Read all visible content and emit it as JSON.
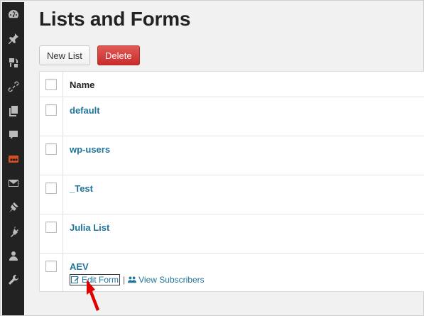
{
  "page": {
    "title": "Lists and Forms"
  },
  "toolbar": {
    "new_list_label": "New List",
    "delete_label": "Delete"
  },
  "table": {
    "name_header": "Name"
  },
  "rows": [
    {
      "name": "default"
    },
    {
      "name": "wp-users"
    },
    {
      "name": "_Test"
    },
    {
      "name": "Julia List"
    },
    {
      "name": "AEV",
      "edit_form": "Edit Form",
      "separator": "|",
      "view_subscribers": "View Subscribers"
    }
  ],
  "sidebar": {
    "icons": [
      "dashboard-icon",
      "pin-icon",
      "media-icon",
      "link-icon",
      "pages-icon",
      "comments-icon",
      "yoo-icon",
      "mail-icon",
      "appearance-icon",
      "plugins-icon",
      "users-icon",
      "tools-icon"
    ]
  },
  "colors": {
    "link": "#21759b",
    "delete": "#c92c2c",
    "sidebar": "#222222",
    "annotation_arrow": "#e00000"
  }
}
